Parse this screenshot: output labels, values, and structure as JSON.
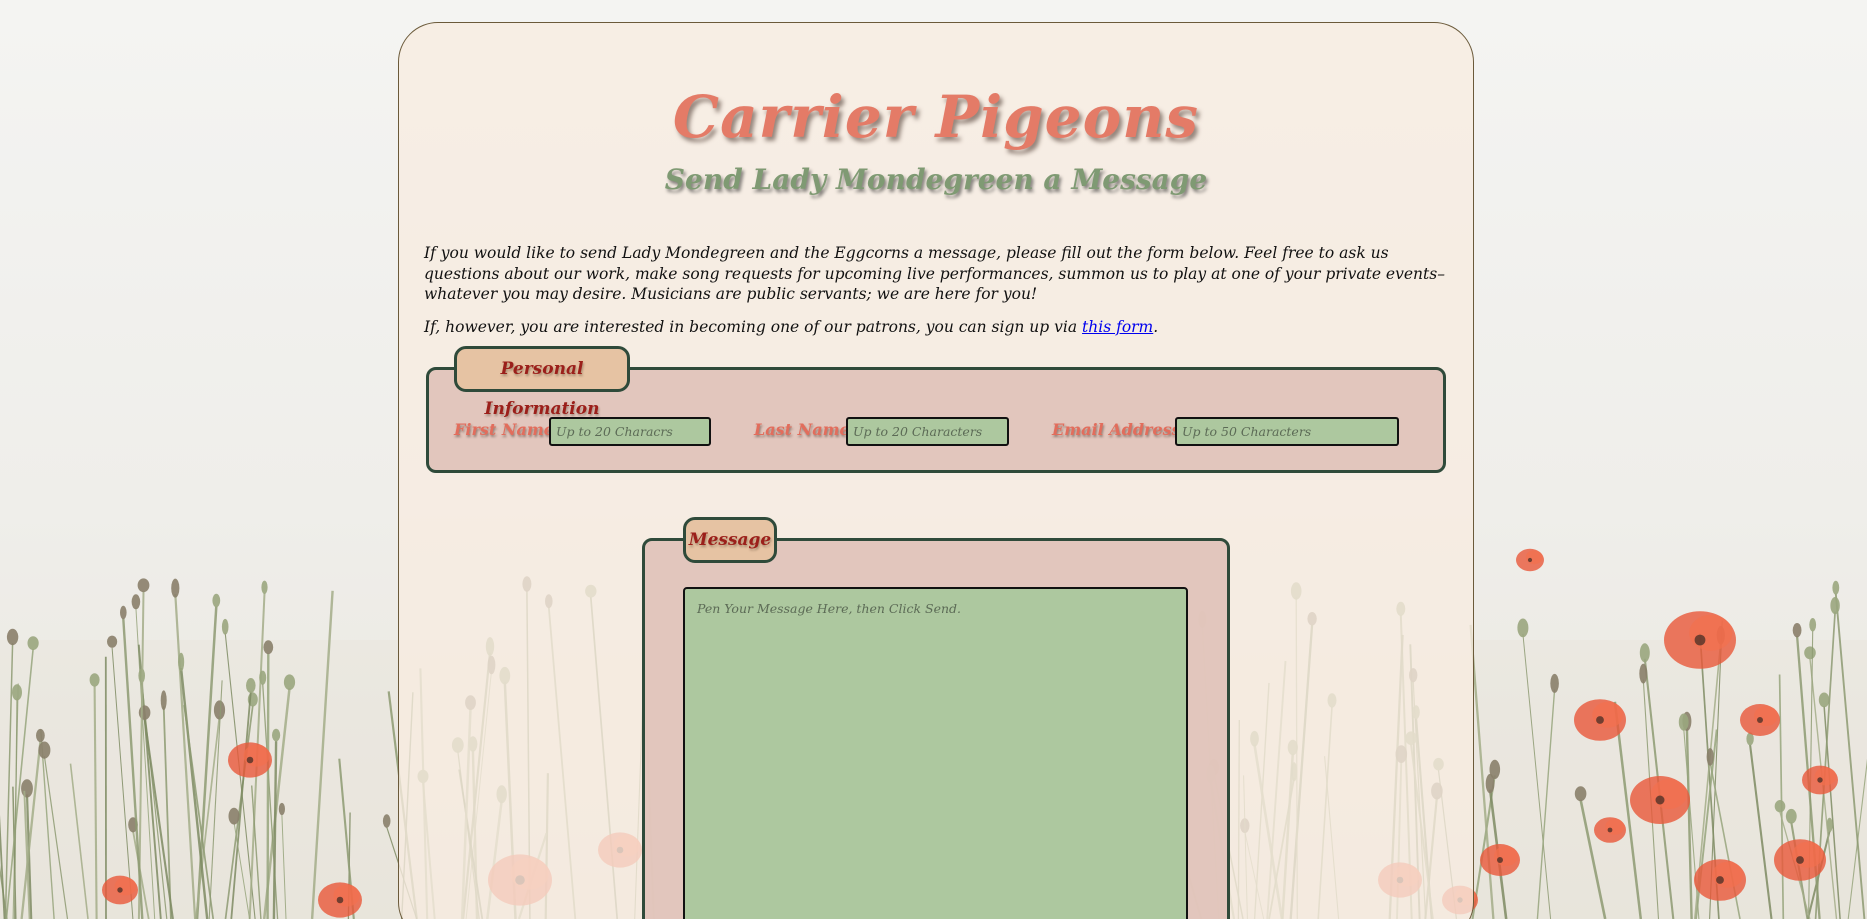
{
  "header": {
    "title": "Carrier Pigeons",
    "subtitle": "Send Lady Mondegreen a Message"
  },
  "intro": {
    "paragraph1": "If you would like to send Lady Mondegreen and the Eggcorns a message, please fill out the form below. Feel free to ask us questions about our work, make song requests for upcoming live performances, summon us to play at one of your private events–whatever you may desire. Musicians are public servants; we are here for you!",
    "paragraph2_prefix": "If, however, you are interested in becoming one of our patrons, you can sign up via ",
    "paragraph2_link": "this form",
    "paragraph2_suffix": "."
  },
  "personal_info": {
    "legend": "Personal Information",
    "first_name_label": "First Name:",
    "first_name_placeholder": "Up to 20 Characrs",
    "last_name_label": "Last Name:",
    "last_name_placeholder": "Up to 20 Characters",
    "email_label": "Email Address:",
    "email_placeholder": "Up to 50 Characters"
  },
  "message": {
    "legend": "Message",
    "placeholder": "Pen Your Message Here, then Click Send."
  },
  "colors": {
    "title": "#e47b67",
    "subtitle": "#7f9a73",
    "legend_bg": "#e6c3a3",
    "legend_text": "#9b1f1a",
    "fieldset_bg": "#e0c4ba",
    "input_bg": "#adc89f",
    "label": "#e26d5c",
    "border": "#2f4a3a",
    "link": "#0000ee"
  }
}
